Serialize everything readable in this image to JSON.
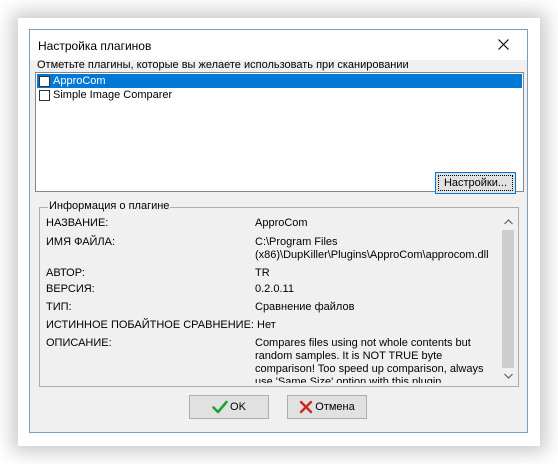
{
  "window": {
    "title": "Настройка плагинов",
    "close_icon": "close-icon"
  },
  "instruction": "Отметьте плагины, которые вы желаете использовать при сканировании",
  "plugins": [
    {
      "label": "ApproCom",
      "checked": false,
      "selected": true
    },
    {
      "label": "Simple Image Comparer",
      "checked": false,
      "selected": false
    }
  ],
  "settings_button": "Настройки...",
  "info": {
    "group_label": "Информация о плагине",
    "rows": [
      {
        "key": "НАЗВАНИЕ:",
        "value": "ApproCom"
      },
      {
        "key": "ИМЯ ФАЙЛА:",
        "value": "C:\\Program Files (x86)\\DupKiller\\Plugins\\ApproCom\\approcom.dll"
      },
      {
        "key": "АВТОР:",
        "value": "TR"
      },
      {
        "key": "ВЕРСИЯ:",
        "value": "0.2.0.11"
      },
      {
        "key": "ТИП:",
        "value": "Сравнение файлов"
      },
      {
        "key": "ИСТИННОЕ ПОБАЙТНОЕ СРАВНЕНИЕ:",
        "value": "Нет"
      },
      {
        "key": "ОПИСАНИЕ:",
        "value": "Compares files using not whole contents but random samples. It is NOT TRUE byte comparison! Too speed up comparison, always use 'Same Size' option with this plugin."
      }
    ]
  },
  "buttons": {
    "ok": "OK",
    "cancel": "Отмена"
  },
  "colors": {
    "selection": "#0078d7",
    "ok_icon": "#1fa13a",
    "cancel_icon": "#d0281e"
  }
}
